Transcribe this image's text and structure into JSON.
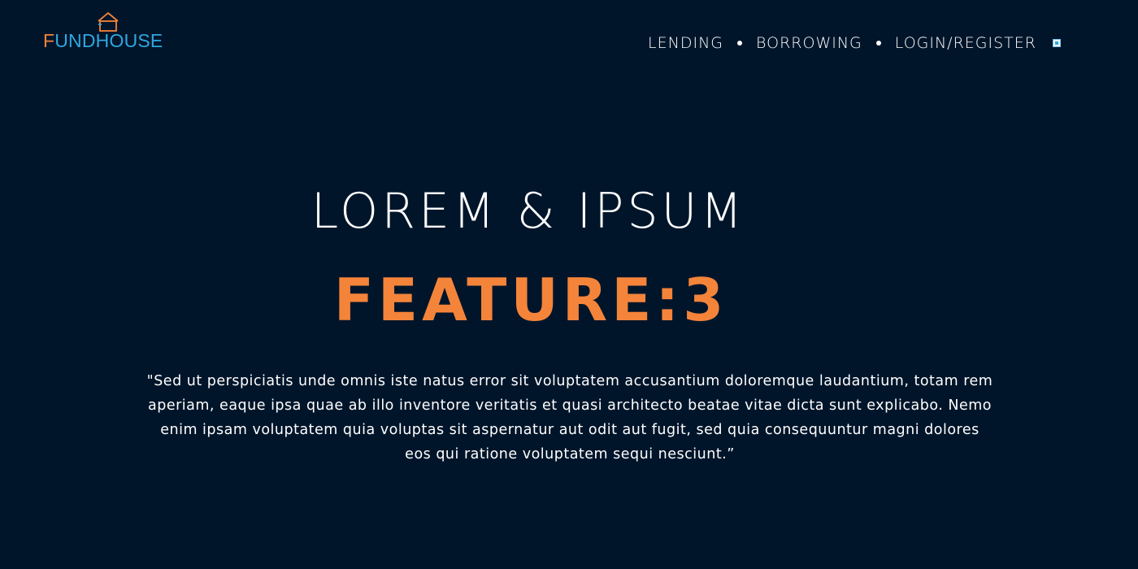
{
  "brand": {
    "logo_first_letter": "F",
    "logo_rest": "UNDHOUSE",
    "logo_icon": "house-outline-icon",
    "colors": {
      "orange": "#f4843a",
      "blue": "#2fa7de",
      "background": "#00152a"
    }
  },
  "nav": {
    "items": [
      {
        "label": "LENDING"
      },
      {
        "label": "BORROWING"
      },
      {
        "label": "LOGIN/REGISTER"
      }
    ],
    "menu_icon": "menu-square-icon"
  },
  "hero": {
    "title": "LOREM & IPSUM",
    "subtitle": "FEATURE:3",
    "quote": "\"Sed ut perspiciatis unde omnis iste natus error sit voluptatem accusantium doloremque laudantium, totam rem aperiam, eaque ipsa quae ab illo inventore veritatis et quasi architecto beatae vitae dicta sunt explicabo. Nemo enim ipsam voluptatem quia voluptas sit aspernatur aut odit aut fugit, sed quia consequuntur magni dolores eos qui ratione voluptatem sequi nesciunt.”"
  }
}
